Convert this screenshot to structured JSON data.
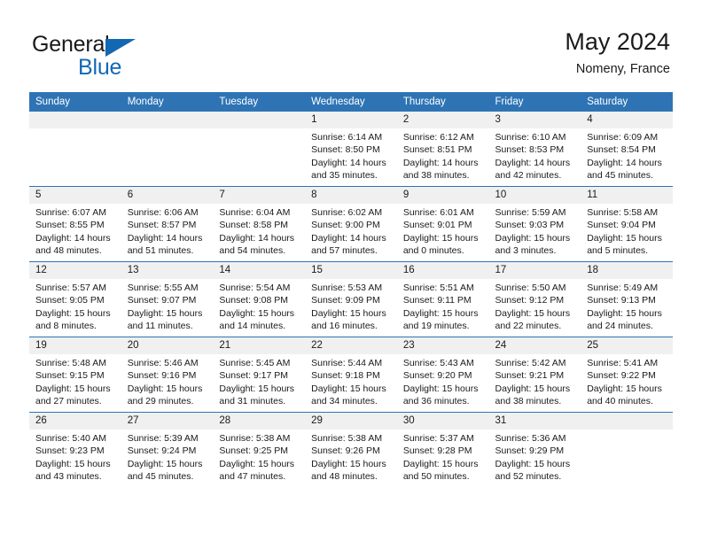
{
  "brand": {
    "name_top": "General",
    "name_bottom": "Blue",
    "accent_color": "#1268b3"
  },
  "header": {
    "title": "May 2024",
    "subtitle": "Nomeny, France"
  },
  "theme": {
    "header_row_color": "#2e74b5",
    "daynum_band_color": "#f0f0f0",
    "text_color": "#1a1a1a"
  },
  "weekday_headers": [
    "Sunday",
    "Monday",
    "Tuesday",
    "Wednesday",
    "Thursday",
    "Friday",
    "Saturday"
  ],
  "labels": {
    "sunrise_prefix": "Sunrise:",
    "sunset_prefix": "Sunset:",
    "daylight_prefix": "Daylight:"
  },
  "weeks": [
    [
      {
        "empty": true
      },
      {
        "empty": true
      },
      {
        "empty": true
      },
      {
        "day": "1",
        "sunrise": "Sunrise: 6:14 AM",
        "sunset": "Sunset: 8:50 PM",
        "daylight_line1": "Daylight: 14 hours",
        "daylight_line2": "and 35 minutes."
      },
      {
        "day": "2",
        "sunrise": "Sunrise: 6:12 AM",
        "sunset": "Sunset: 8:51 PM",
        "daylight_line1": "Daylight: 14 hours",
        "daylight_line2": "and 38 minutes."
      },
      {
        "day": "3",
        "sunrise": "Sunrise: 6:10 AM",
        "sunset": "Sunset: 8:53 PM",
        "daylight_line1": "Daylight: 14 hours",
        "daylight_line2": "and 42 minutes."
      },
      {
        "day": "4",
        "sunrise": "Sunrise: 6:09 AM",
        "sunset": "Sunset: 8:54 PM",
        "daylight_line1": "Daylight: 14 hours",
        "daylight_line2": "and 45 minutes."
      }
    ],
    [
      {
        "day": "5",
        "sunrise": "Sunrise: 6:07 AM",
        "sunset": "Sunset: 8:55 PM",
        "daylight_line1": "Daylight: 14 hours",
        "daylight_line2": "and 48 minutes."
      },
      {
        "day": "6",
        "sunrise": "Sunrise: 6:06 AM",
        "sunset": "Sunset: 8:57 PM",
        "daylight_line1": "Daylight: 14 hours",
        "daylight_line2": "and 51 minutes."
      },
      {
        "day": "7",
        "sunrise": "Sunrise: 6:04 AM",
        "sunset": "Sunset: 8:58 PM",
        "daylight_line1": "Daylight: 14 hours",
        "daylight_line2": "and 54 minutes."
      },
      {
        "day": "8",
        "sunrise": "Sunrise: 6:02 AM",
        "sunset": "Sunset: 9:00 PM",
        "daylight_line1": "Daylight: 14 hours",
        "daylight_line2": "and 57 minutes."
      },
      {
        "day": "9",
        "sunrise": "Sunrise: 6:01 AM",
        "sunset": "Sunset: 9:01 PM",
        "daylight_line1": "Daylight: 15 hours",
        "daylight_line2": "and 0 minutes."
      },
      {
        "day": "10",
        "sunrise": "Sunrise: 5:59 AM",
        "sunset": "Sunset: 9:03 PM",
        "daylight_line1": "Daylight: 15 hours",
        "daylight_line2": "and 3 minutes."
      },
      {
        "day": "11",
        "sunrise": "Sunrise: 5:58 AM",
        "sunset": "Sunset: 9:04 PM",
        "daylight_line1": "Daylight: 15 hours",
        "daylight_line2": "and 5 minutes."
      }
    ],
    [
      {
        "day": "12",
        "sunrise": "Sunrise: 5:57 AM",
        "sunset": "Sunset: 9:05 PM",
        "daylight_line1": "Daylight: 15 hours",
        "daylight_line2": "and 8 minutes."
      },
      {
        "day": "13",
        "sunrise": "Sunrise: 5:55 AM",
        "sunset": "Sunset: 9:07 PM",
        "daylight_line1": "Daylight: 15 hours",
        "daylight_line2": "and 11 minutes."
      },
      {
        "day": "14",
        "sunrise": "Sunrise: 5:54 AM",
        "sunset": "Sunset: 9:08 PM",
        "daylight_line1": "Daylight: 15 hours",
        "daylight_line2": "and 14 minutes."
      },
      {
        "day": "15",
        "sunrise": "Sunrise: 5:53 AM",
        "sunset": "Sunset: 9:09 PM",
        "daylight_line1": "Daylight: 15 hours",
        "daylight_line2": "and 16 minutes."
      },
      {
        "day": "16",
        "sunrise": "Sunrise: 5:51 AM",
        "sunset": "Sunset: 9:11 PM",
        "daylight_line1": "Daylight: 15 hours",
        "daylight_line2": "and 19 minutes."
      },
      {
        "day": "17",
        "sunrise": "Sunrise: 5:50 AM",
        "sunset": "Sunset: 9:12 PM",
        "daylight_line1": "Daylight: 15 hours",
        "daylight_line2": "and 22 minutes."
      },
      {
        "day": "18",
        "sunrise": "Sunrise: 5:49 AM",
        "sunset": "Sunset: 9:13 PM",
        "daylight_line1": "Daylight: 15 hours",
        "daylight_line2": "and 24 minutes."
      }
    ],
    [
      {
        "day": "19",
        "sunrise": "Sunrise: 5:48 AM",
        "sunset": "Sunset: 9:15 PM",
        "daylight_line1": "Daylight: 15 hours",
        "daylight_line2": "and 27 minutes."
      },
      {
        "day": "20",
        "sunrise": "Sunrise: 5:46 AM",
        "sunset": "Sunset: 9:16 PM",
        "daylight_line1": "Daylight: 15 hours",
        "daylight_line2": "and 29 minutes."
      },
      {
        "day": "21",
        "sunrise": "Sunrise: 5:45 AM",
        "sunset": "Sunset: 9:17 PM",
        "daylight_line1": "Daylight: 15 hours",
        "daylight_line2": "and 31 minutes."
      },
      {
        "day": "22",
        "sunrise": "Sunrise: 5:44 AM",
        "sunset": "Sunset: 9:18 PM",
        "daylight_line1": "Daylight: 15 hours",
        "daylight_line2": "and 34 minutes."
      },
      {
        "day": "23",
        "sunrise": "Sunrise: 5:43 AM",
        "sunset": "Sunset: 9:20 PM",
        "daylight_line1": "Daylight: 15 hours",
        "daylight_line2": "and 36 minutes."
      },
      {
        "day": "24",
        "sunrise": "Sunrise: 5:42 AM",
        "sunset": "Sunset: 9:21 PM",
        "daylight_line1": "Daylight: 15 hours",
        "daylight_line2": "and 38 minutes."
      },
      {
        "day": "25",
        "sunrise": "Sunrise: 5:41 AM",
        "sunset": "Sunset: 9:22 PM",
        "daylight_line1": "Daylight: 15 hours",
        "daylight_line2": "and 40 minutes."
      }
    ],
    [
      {
        "day": "26",
        "sunrise": "Sunrise: 5:40 AM",
        "sunset": "Sunset: 9:23 PM",
        "daylight_line1": "Daylight: 15 hours",
        "daylight_line2": "and 43 minutes."
      },
      {
        "day": "27",
        "sunrise": "Sunrise: 5:39 AM",
        "sunset": "Sunset: 9:24 PM",
        "daylight_line1": "Daylight: 15 hours",
        "daylight_line2": "and 45 minutes."
      },
      {
        "day": "28",
        "sunrise": "Sunrise: 5:38 AM",
        "sunset": "Sunset: 9:25 PM",
        "daylight_line1": "Daylight: 15 hours",
        "daylight_line2": "and 47 minutes."
      },
      {
        "day": "29",
        "sunrise": "Sunrise: 5:38 AM",
        "sunset": "Sunset: 9:26 PM",
        "daylight_line1": "Daylight: 15 hours",
        "daylight_line2": "and 48 minutes."
      },
      {
        "day": "30",
        "sunrise": "Sunrise: 5:37 AM",
        "sunset": "Sunset: 9:28 PM",
        "daylight_line1": "Daylight: 15 hours",
        "daylight_line2": "and 50 minutes."
      },
      {
        "day": "31",
        "sunrise": "Sunrise: 5:36 AM",
        "sunset": "Sunset: 9:29 PM",
        "daylight_line1": "Daylight: 15 hours",
        "daylight_line2": "and 52 minutes."
      },
      {
        "empty": true
      }
    ]
  ]
}
